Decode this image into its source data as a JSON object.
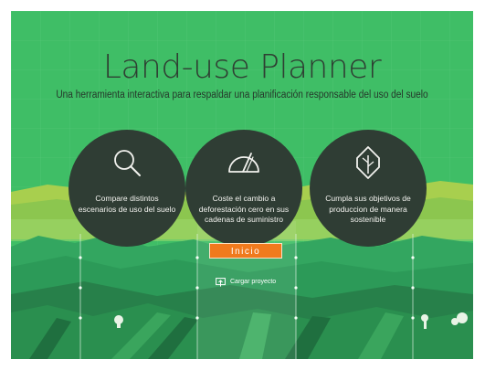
{
  "header": {
    "title": "Land-use Planner",
    "subtitle": "Una herramienta interactiva para respaldar una planificación responsable del uso del suelo"
  },
  "features": [
    {
      "icon": "search-icon",
      "text": "Compare distintos escenarios de uso del suelo"
    },
    {
      "icon": "gauge-icon",
      "text": "Coste el cambio a deforestación cero en sus cadenas de suministro"
    },
    {
      "icon": "leaf-icon",
      "text": "Cumpla sus objetivos de produccion de manera sostenible"
    }
  ],
  "actions": {
    "start_label": "Inicio",
    "load_label": "Cargar proyecto"
  },
  "colors": {
    "background": "#3fbe66",
    "circle": "#2f3d34",
    "accent": "#f07a1d"
  }
}
